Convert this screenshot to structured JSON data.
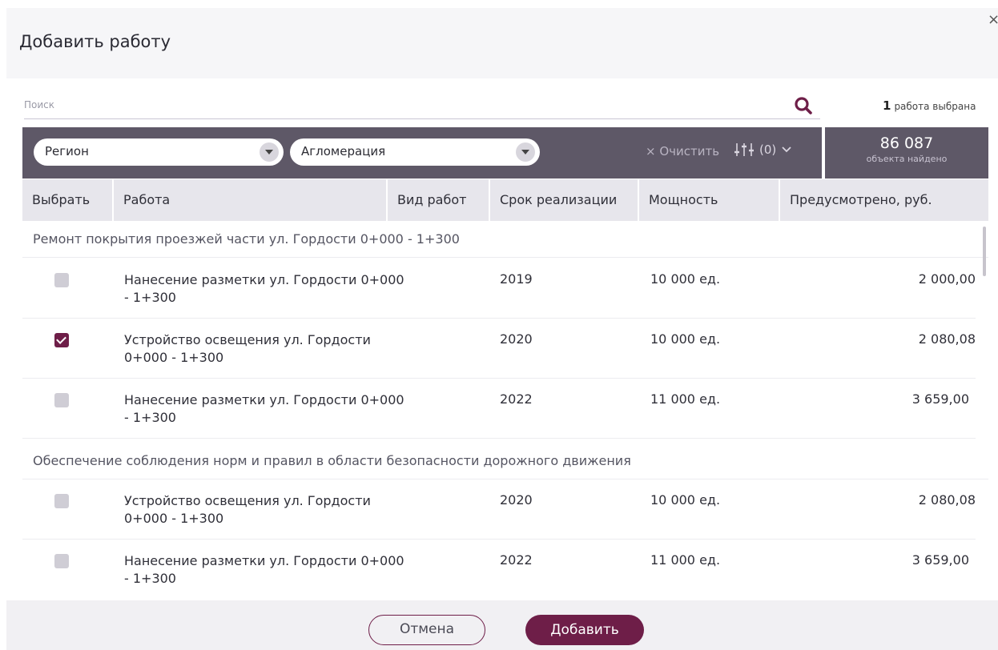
{
  "dialog": {
    "title": "Добавить работу",
    "close_symbol": "×"
  },
  "search": {
    "placeholder": "Поиск",
    "value": ""
  },
  "selection": {
    "count": "1",
    "label": "работа выбрана"
  },
  "filters": {
    "region_label": "Регион",
    "agglomeration_label": "Агломерация",
    "clear_label": "Очистить",
    "clear_symbol": "×",
    "filters_count": "(0)"
  },
  "found": {
    "count": "86 087",
    "label": "объекта найдено"
  },
  "table": {
    "headers": [
      "Выбрать",
      "Работа",
      "Вид работ",
      "Срок реализации",
      "Мощность",
      "Предусмотрено, руб."
    ],
    "groups": [
      {
        "title": "Ремонт покрытия проезжей части ул. Гордости 0+000 - 1+300",
        "rows": [
          {
            "checked": false,
            "work": "Нанесение разметки ул. Гордости 0+000 - 1+300",
            "type": "",
            "year": "2019",
            "capacity": "10 000 ед.",
            "amount": "2 000,00"
          },
          {
            "checked": true,
            "work": "Устройство освещения ул. Гордости 0+000 - 1+300",
            "type": "",
            "year": "2020",
            "capacity": "10 000 ед.",
            "amount": "2 080,08"
          },
          {
            "checked": false,
            "work": "Нанесение разметки ул. Гордости 0+000 - 1+300",
            "type": "",
            "year": "2022",
            "capacity": "11 000 ед.",
            "amount": "3 659,00"
          }
        ]
      },
      {
        "title": "Обеспечение соблюдения норм и правил в области безопасности дорожного движения",
        "rows": [
          {
            "checked": false,
            "work": "Устройство освещения ул. Гордости 0+000 - 1+300",
            "type": "",
            "year": "2020",
            "capacity": "10 000 ед.",
            "amount": "2 080,08"
          },
          {
            "checked": false,
            "work": "Нанесение разметки ул. Гордости 0+000 - 1+300",
            "type": "",
            "year": "2022",
            "capacity": "11 000 ед.",
            "amount": "3 659,00"
          }
        ]
      }
    ]
  },
  "footer": {
    "cancel_label": "Отмена",
    "add_label": "Добавить"
  },
  "colors": {
    "accent": "#6e1e48",
    "filter_bar": "#5e5867",
    "header_bg": "#e7e6ec"
  }
}
